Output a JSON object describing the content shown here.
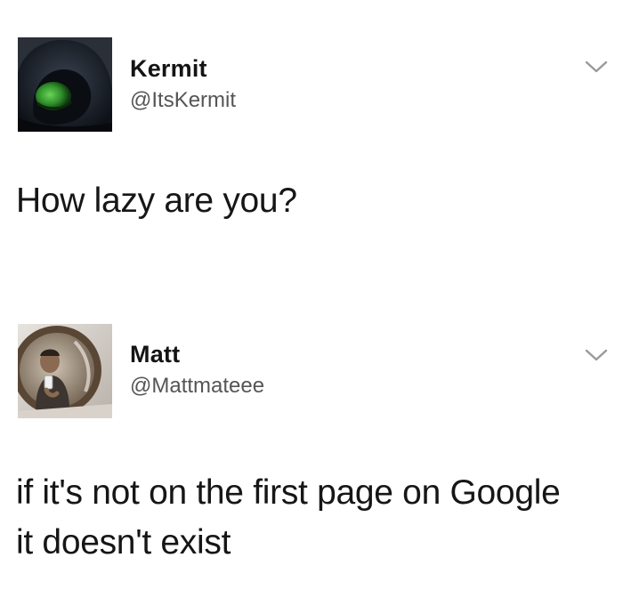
{
  "tweets": [
    {
      "display_name": "Kermit",
      "handle": "@ItsKermit",
      "text": "How lazy are you?",
      "avatar_icon": "hooded-kermit-avatar",
      "menu_icon": "chevron-down-icon"
    },
    {
      "display_name": "Matt",
      "handle": "@Mattmateee",
      "text_lines": [
        "if it's not on the first page on Google",
        "it doesn't exist"
      ],
      "avatar_icon": "mirror-selfie-avatar",
      "menu_icon": "chevron-down-icon"
    }
  ],
  "colors": {
    "background": "#ffffff",
    "text": "#161616",
    "handle": "#555555",
    "chevron": "#9a9a9a"
  }
}
